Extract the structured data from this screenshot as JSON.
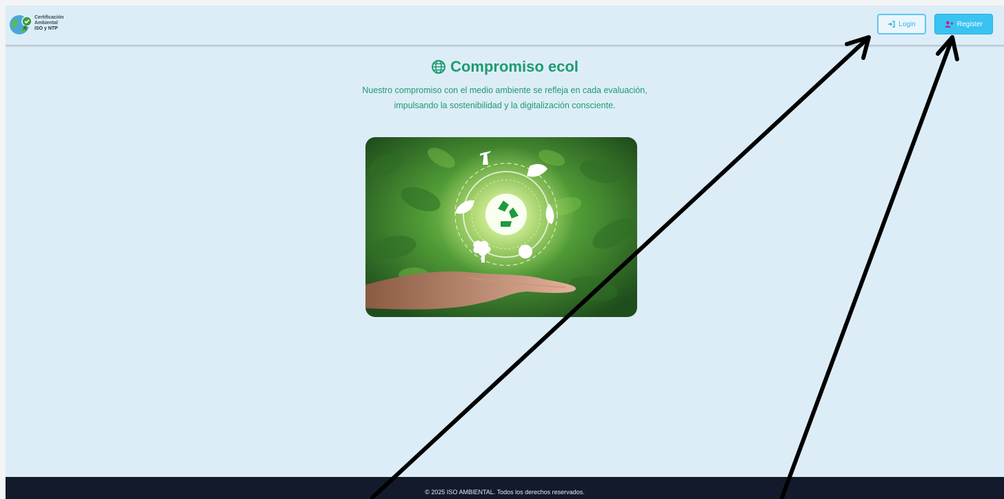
{
  "header": {
    "logo": {
      "line1": "Certificación",
      "line2": "Ambiental",
      "line3": "ISO y NTP",
      "icon": "globe-badge-logo"
    },
    "login_label": "Login",
    "login_icon": "sign-in-icon",
    "register_label": "Register",
    "register_icon": "user-plus-icon"
  },
  "main": {
    "title": "Compromiso ecol",
    "title_icon": "globe-icon",
    "subtitle_line1": "Nuestro compromiso con el medio ambiente se refleja en cada evaluación,",
    "subtitle_line2": "impulsando la sostenibilidad y la digitalización consciente.",
    "hero_image": "hand-holding-recycle-eco-icons-over-green-leaves"
  },
  "footer": {
    "text": "© 2025 ISO AMBIENTAL. Todos los derechos reservados."
  },
  "colors": {
    "page_bg": "#dcedf8",
    "accent_green": "#1e9b6e",
    "register_bg": "#38c3f2",
    "login_border": "#5cc6ec",
    "footer_bg": "#121a2b"
  }
}
